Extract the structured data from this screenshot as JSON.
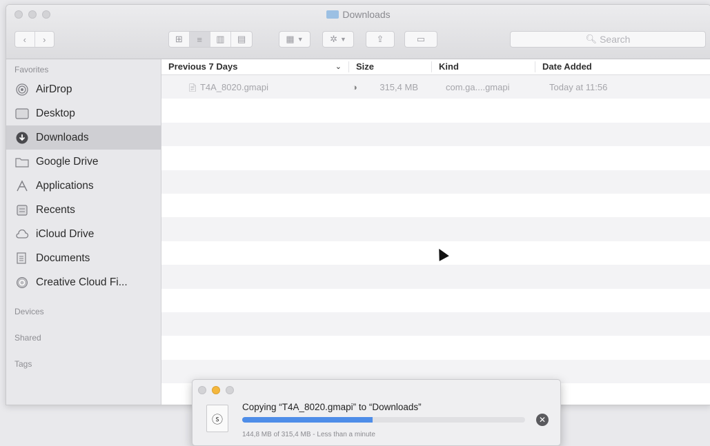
{
  "window": {
    "title": "Downloads"
  },
  "toolbar": {
    "back_icon": "chevron-left-icon",
    "forward_icon": "chevron-right-icon",
    "view_icon_grid": "⊞",
    "view_list": "≡",
    "view_columns": "▥",
    "view_gallery": "▤",
    "group_icon": "▦",
    "action_icon": "✲",
    "share_icon": "⇪",
    "tag_icon": "▭",
    "search_placeholder": "Search"
  },
  "sidebar": {
    "favorites_label": "Favorites",
    "items": [
      {
        "label": "AirDrop",
        "icon": "airdrop-icon"
      },
      {
        "label": "Desktop",
        "icon": "desktop-icon"
      },
      {
        "label": "Downloads",
        "icon": "downloads-icon",
        "selected": true
      },
      {
        "label": "Google Drive",
        "icon": "folder-icon"
      },
      {
        "label": "Applications",
        "icon": "applications-icon"
      },
      {
        "label": "Recents",
        "icon": "recents-icon"
      },
      {
        "label": "iCloud Drive",
        "icon": "cloud-icon"
      },
      {
        "label": "Documents",
        "icon": "documents-icon"
      },
      {
        "label": "Creative Cloud Fi...",
        "icon": "creative-cloud-icon"
      }
    ],
    "devices_label": "Devices",
    "shared_label": "Shared",
    "tags_label": "Tags"
  },
  "columns": {
    "name": "Previous 7 Days",
    "size": "Size",
    "kind": "Kind",
    "date_added": "Date Added"
  },
  "files": [
    {
      "name": "T4A_8020.gmapi",
      "size": "315,4 MB",
      "kind": "com.ga....gmapi",
      "date_added": "Today at 11:56"
    }
  ],
  "copy_dialog": {
    "title": "Copying “T4A_8020.gmapi” to “Downloads”",
    "status": "144,8 MB of 315,4 MB - Less than a minute",
    "progress_fraction": 0.46
  }
}
